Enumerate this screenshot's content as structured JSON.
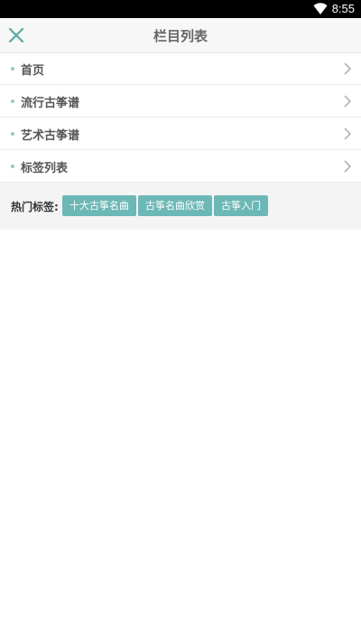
{
  "status_bar": {
    "time": "8:55",
    "wifi_icon": "wifi-icon"
  },
  "header": {
    "title": "栏目列表",
    "close_icon": "close-icon",
    "accent": "#5aa9a6"
  },
  "menu": {
    "items": [
      {
        "label": "首页"
      },
      {
        "label": "流行古筝谱"
      },
      {
        "label": "艺术古筝谱"
      },
      {
        "label": "标签列表"
      }
    ]
  },
  "hot_tags": {
    "label": "热门标签:",
    "tags": [
      "十大古筝名曲",
      "古筝名曲欣赏",
      "古筝入门"
    ],
    "tag_color": "#6cb8b6"
  }
}
